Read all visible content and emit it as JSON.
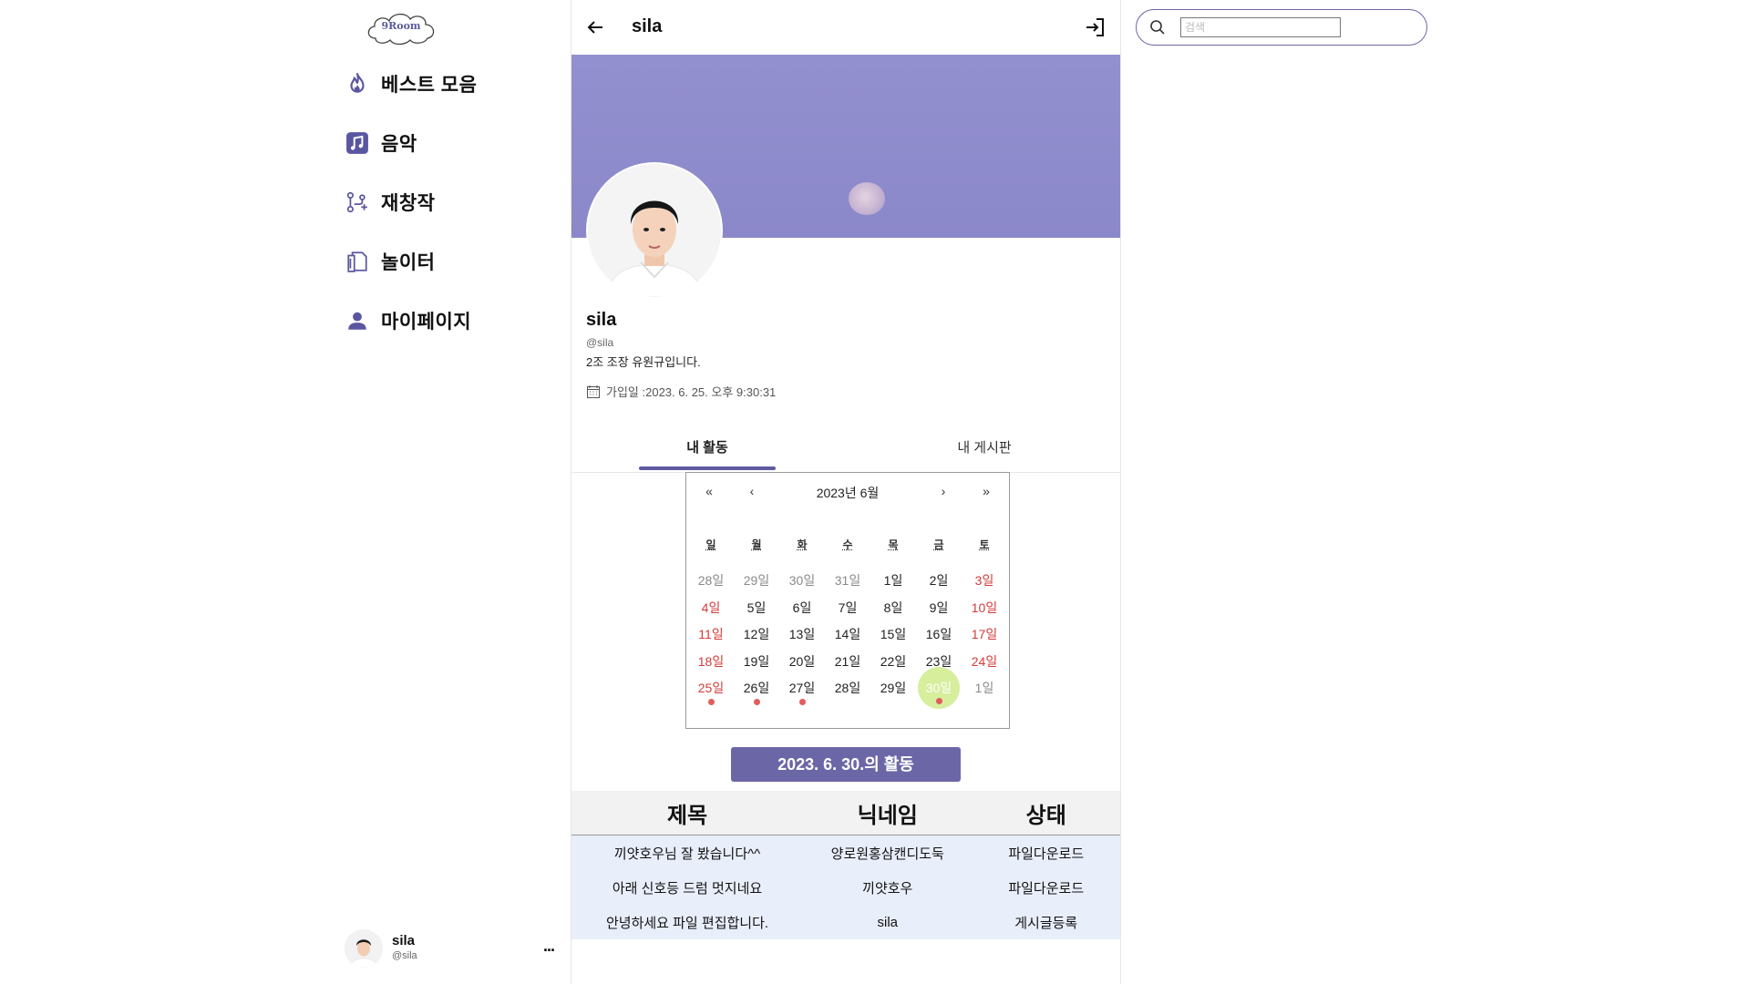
{
  "sidebar": {
    "logo_text": "9Room",
    "items": [
      {
        "label": "베스트 모음",
        "icon": "flame-icon"
      },
      {
        "label": "음악",
        "icon": "music-note-icon"
      },
      {
        "label": "재창작",
        "icon": "git-branch-icon"
      },
      {
        "label": "놀이터",
        "icon": "clipboard-icon"
      },
      {
        "label": "마이페이지",
        "icon": "user-icon"
      }
    ],
    "account": {
      "name": "sila",
      "handle": "@sila",
      "more": "..."
    }
  },
  "header": {
    "title": "sila"
  },
  "profile": {
    "name": "sila",
    "handle": "@sila",
    "bio": "2조 조장 유원규입니다.",
    "joined": "가입일 :2023. 6. 25. 오후 9:30:31"
  },
  "tabs": [
    {
      "label": "내 활동",
      "active": true
    },
    {
      "label": "내 게시판",
      "active": false
    }
  ],
  "calendar": {
    "nav_first": "«",
    "nav_prev": "‹",
    "month_label": "2023년 6월",
    "nav_next": "›",
    "nav_last": "»",
    "weekdays": [
      "일",
      "월",
      "화",
      "수",
      "목",
      "금",
      "토"
    ],
    "weeks": [
      [
        {
          "d": "28일",
          "muted": true
        },
        {
          "d": "29일",
          "muted": true
        },
        {
          "d": "30일",
          "muted": true
        },
        {
          "d": "31일",
          "muted": true
        },
        {
          "d": "1일"
        },
        {
          "d": "2일"
        },
        {
          "d": "3일",
          "weekend": true
        }
      ],
      [
        {
          "d": "4일",
          "weekend": true
        },
        {
          "d": "5일"
        },
        {
          "d": "6일"
        },
        {
          "d": "7일"
        },
        {
          "d": "8일"
        },
        {
          "d": "9일"
        },
        {
          "d": "10일",
          "weekend": true
        }
      ],
      [
        {
          "d": "11일",
          "weekend": true
        },
        {
          "d": "12일"
        },
        {
          "d": "13일"
        },
        {
          "d": "14일"
        },
        {
          "d": "15일"
        },
        {
          "d": "16일"
        },
        {
          "d": "17일",
          "weekend": true
        }
      ],
      [
        {
          "d": "18일",
          "weekend": true
        },
        {
          "d": "19일"
        },
        {
          "d": "20일"
        },
        {
          "d": "21일"
        },
        {
          "d": "22일"
        },
        {
          "d": "23일"
        },
        {
          "d": "24일",
          "weekend": true
        }
      ],
      [
        {
          "d": "25일",
          "weekend": true,
          "dot": true
        },
        {
          "d": "26일",
          "dot": true
        },
        {
          "d": "27일",
          "dot": true
        },
        {
          "d": "28일"
        },
        {
          "d": "29일"
        },
        {
          "d": "30일",
          "today": true,
          "dot": true
        },
        {
          "d": "1일",
          "muted": true
        }
      ]
    ]
  },
  "activity": {
    "button_label": "2023. 6. 30.의 활동",
    "columns": [
      "제목",
      "닉네임",
      "상태"
    ],
    "rows": [
      [
        "끼얏호우님 잘 봤습니다^^",
        "양로원홍삼캔디도둑",
        "파일다운로드"
      ],
      [
        "아래 신호등 드럼 멋지네요",
        "끼얏호우",
        "파일다운로드"
      ],
      [
        "안녕하세요 파일 편집합니다.",
        "sila",
        "게시글등록"
      ]
    ]
  },
  "search": {
    "placeholder": "검색"
  },
  "colors": {
    "accent": "#6b67a6",
    "banner": "#8f8ccd",
    "today_highlight": "#d7ee9d",
    "weekend_text": "#d23b3b",
    "event_dot": "#e25c5c",
    "table_row_bg": "#e9eefb"
  }
}
